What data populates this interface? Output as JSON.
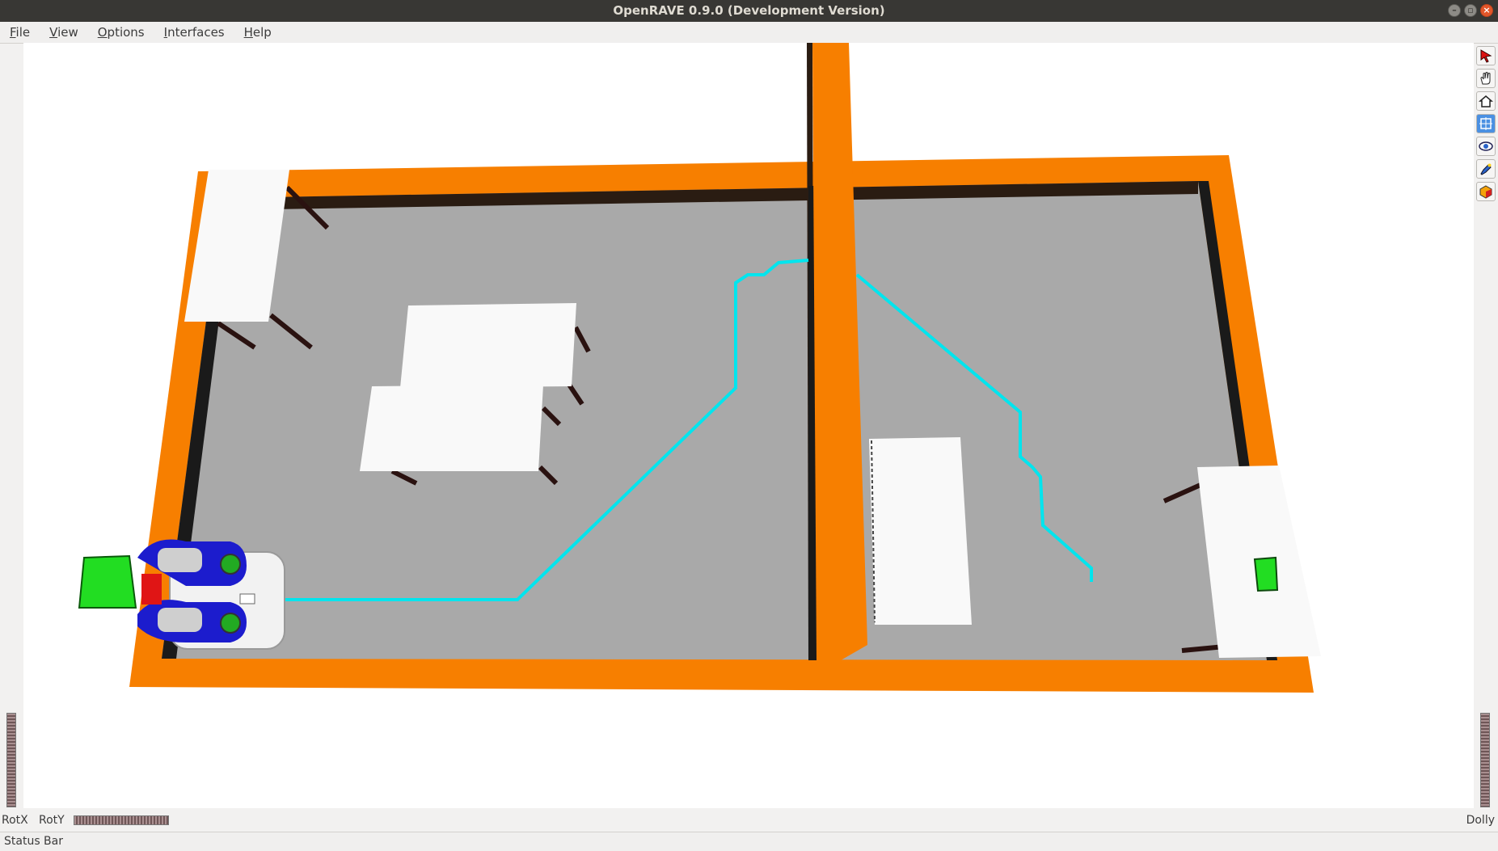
{
  "window": {
    "title": "OpenRAVE 0.9.0 (Development Version)"
  },
  "menu": [
    "File",
    "View",
    "Options",
    "Interfaces",
    "Help"
  ],
  "toolbar": [
    {
      "name": "select-arrow-icon"
    },
    {
      "name": "pan-hand-icon"
    },
    {
      "name": "home-view-icon"
    },
    {
      "name": "view-all-icon"
    },
    {
      "name": "eye-view-icon"
    },
    {
      "name": "seek-flashlight-icon"
    },
    {
      "name": "projection-cube-icon"
    }
  ],
  "controls": {
    "rotx": "RotX",
    "roty": "RotY",
    "dolly": "Dolly"
  },
  "status": "Status Bar",
  "colors": {
    "wall": "#f77f00",
    "wall_shadow": "#2a1c12",
    "floor": "#a9a9a9",
    "table": "#f9f9f9",
    "path": "#00e5ee",
    "robot_green": "#22dd22",
    "robot_blue": "#1c1ccd",
    "robot_red": "#e01515"
  }
}
